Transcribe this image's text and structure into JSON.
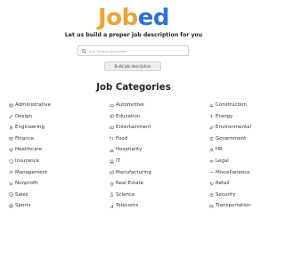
{
  "brand": {
    "logo_part1": "Job",
    "logo_part2": "ed",
    "color_part1": "#f0a133",
    "color_part2": "#2f6fd8",
    "tagline": "Let us build a proper job description for you"
  },
  "search": {
    "placeholder": "e.g. Python Developer",
    "value": ""
  },
  "build_button": {
    "label": "Build job description"
  },
  "categories_section": {
    "title": "Job Categories",
    "columns": [
      [
        {
          "label": "Administrative",
          "icon": "pencil-icon"
        },
        {
          "label": "Design",
          "icon": "brush-icon"
        },
        {
          "label": "Engineering",
          "icon": "engineer-icon"
        },
        {
          "label": "Finance",
          "icon": "finance-icon"
        },
        {
          "label": "Healthcare",
          "icon": "healthcare-icon"
        },
        {
          "label": "Insurance",
          "icon": "shield-icon"
        },
        {
          "label": "Management",
          "icon": "management-icon"
        },
        {
          "label": "Nonprofit",
          "icon": "handshake-icon"
        },
        {
          "label": "Sales",
          "icon": "sales-icon"
        },
        {
          "label": "Sports",
          "icon": "sports-icon"
        }
      ],
      [
        {
          "label": "Automotive",
          "icon": "car-icon"
        },
        {
          "label": "Education",
          "icon": "book-icon"
        },
        {
          "label": "Entertainment",
          "icon": "entertainment-icon"
        },
        {
          "label": "Food",
          "icon": "food-icon"
        },
        {
          "label": "Hospitality",
          "icon": "hospitality-icon"
        },
        {
          "label": "IT",
          "icon": "laptop-icon"
        },
        {
          "label": "Manufacturing",
          "icon": "factory-icon"
        },
        {
          "label": "Real Estate",
          "icon": "house-icon"
        },
        {
          "label": "Science",
          "icon": "flask-icon"
        },
        {
          "label": "Telecoms",
          "icon": "signal-icon"
        }
      ],
      [
        {
          "label": "Construction",
          "icon": "construction-icon"
        },
        {
          "label": "Energy",
          "icon": "bolt-icon"
        },
        {
          "label": "Environmental",
          "icon": "leaf-icon"
        },
        {
          "label": "Government",
          "icon": "bank-icon"
        },
        {
          "label": "HR",
          "icon": "people-icon"
        },
        {
          "label": "Legal",
          "icon": "scales-icon"
        },
        {
          "label": "Miscellaneous",
          "icon": "misc-icon"
        },
        {
          "label": "Retail",
          "icon": "cart-icon"
        },
        {
          "label": "Security",
          "icon": "lock-icon"
        },
        {
          "label": "Transportation",
          "icon": "truck-icon"
        }
      ]
    ]
  }
}
